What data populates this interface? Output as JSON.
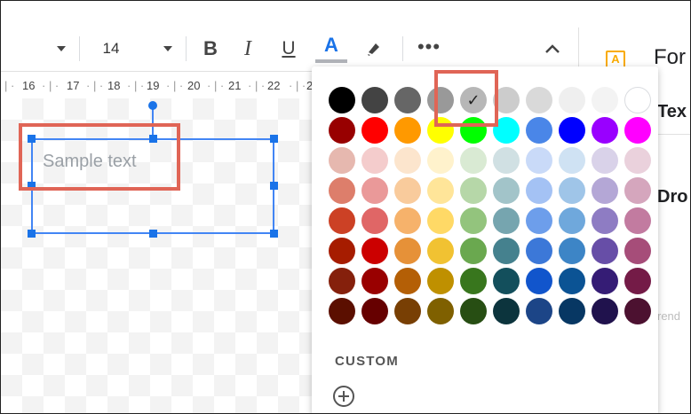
{
  "toolbar": {
    "font_size": "14",
    "bold_label": "B",
    "italic_label": "I",
    "underline_label": "U",
    "text_color_label": "A",
    "more_label": "•••"
  },
  "ruler": {
    "ticks": [
      "16",
      "17",
      "18",
      "19",
      "20",
      "21",
      "22",
      "2"
    ]
  },
  "canvas": {
    "sample_text": "Sample text"
  },
  "palette": {
    "rows": [
      [
        "#000000",
        "#434343",
        "#666666",
        "#999999",
        "#b7b7b7",
        "#cccccc",
        "#d9d9d9",
        "#efefef",
        "#f3f3f3",
        "#ffffff"
      ],
      [
        "#980000",
        "#ff0000",
        "#ff9900",
        "#ffff00",
        "#00ff00",
        "#00ffff",
        "#4a86e8",
        "#0000ff",
        "#9900ff",
        "#ff00ff"
      ],
      [
        "#e6b8af",
        "#f4cccc",
        "#fce5cd",
        "#fff2cc",
        "#d9ead3",
        "#d0e0e3",
        "#c9daf8",
        "#cfe2f3",
        "#d9d2e9",
        "#ead1dc"
      ],
      [
        "#dd7e6b",
        "#ea9999",
        "#f9cb9c",
        "#ffe599",
        "#b6d7a8",
        "#a2c4c9",
        "#a4c2f4",
        "#9fc5e8",
        "#b4a7d6",
        "#d5a6bd"
      ],
      [
        "#cc4125",
        "#e06666",
        "#f6b26b",
        "#ffd966",
        "#93c47d",
        "#76a5af",
        "#6d9eeb",
        "#6fa8dc",
        "#8e7cc3",
        "#c27ba0"
      ],
      [
        "#a61c00",
        "#cc0000",
        "#e69138",
        "#f1c232",
        "#6aa84f",
        "#45818e",
        "#3c78d8",
        "#3d85c6",
        "#674ea7",
        "#a64d79"
      ],
      [
        "#85200c",
        "#990000",
        "#b45f06",
        "#bf9000",
        "#38761d",
        "#134f5c",
        "#1155cc",
        "#0b5394",
        "#351c75",
        "#741b47"
      ],
      [
        "#5b0f00",
        "#660000",
        "#783f04",
        "#7f6000",
        "#274e13",
        "#0c343d",
        "#1c4587",
        "#073763",
        "#20124d",
        "#4c1130"
      ]
    ],
    "selected_row": 0,
    "selected_col": 4,
    "check_glyph": "✓",
    "custom_label": "CUSTOM"
  },
  "right_panel": {
    "title": "For",
    "section_1": "Tex",
    "section_2": "Dro",
    "faint_text": "rend",
    "icon_label": "A"
  },
  "colors": {
    "accent": "#1a73e8",
    "highlight": "#e06556",
    "selection": "#4285f4"
  }
}
